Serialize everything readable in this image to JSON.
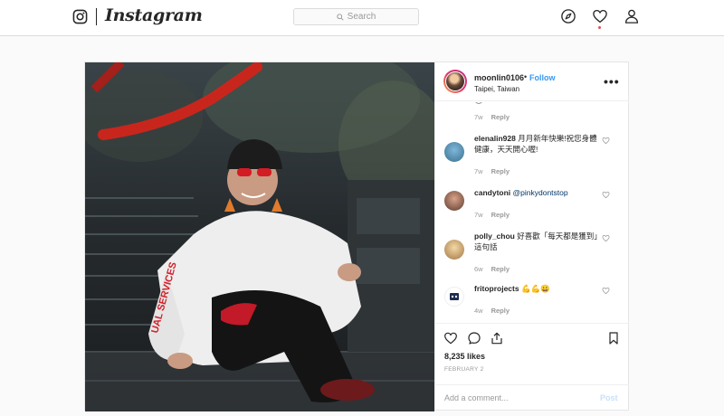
{
  "header": {
    "wordmark": "Instagram",
    "search_placeholder": "Search",
    "icons": [
      "instagram-glyph-icon",
      "compass-icon",
      "heart-icon",
      "profile-icon"
    ]
  },
  "post": {
    "username": "moonlin0106",
    "separator": "•",
    "follow_label": "Follow",
    "location": "Taipei, Taiwan",
    "more_label": "•••",
    "top_meta": {
      "age": "7w",
      "reply": "Reply"
    },
    "comments": [
      {
        "user": "elenalin928",
        "text": "月月新年快樂!祝您身體健康，天天開心喔!",
        "age": "7w",
        "reply": "Reply"
      },
      {
        "user": "candytoni",
        "mention": "@pinkydontstop",
        "text": "",
        "age": "7w",
        "reply": "Reply"
      },
      {
        "user": "polly_chou",
        "text": "好喜歡「每天都是獲到」這句話",
        "age": "6w",
        "reply": "Reply"
      },
      {
        "user": "fritoprojects",
        "text": "💪💪😀",
        "age": "4w",
        "reply": "Reply"
      }
    ],
    "likes": "8,235 likes",
    "date": "FEBRUARY 2",
    "add_comment_placeholder": "Add a comment...",
    "post_label": "Post"
  },
  "colors": {
    "accent": "#3897f0",
    "notification": "#ed4956",
    "border": "#dbdbdb"
  }
}
